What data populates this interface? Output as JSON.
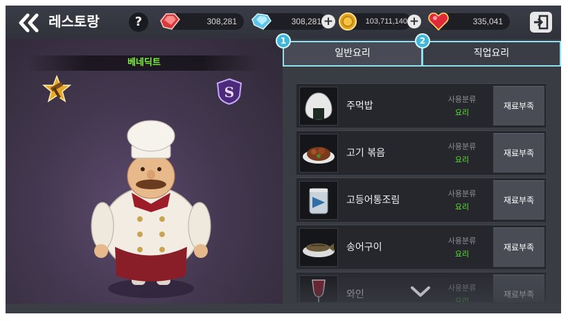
{
  "header": {
    "title": "레스토랑",
    "help_label": "?",
    "resources": [
      {
        "icon": "red-gem-icon",
        "value": "308,281"
      },
      {
        "icon": "blue-gem-icon",
        "value": "308,281"
      },
      {
        "icon": "gold-coin-icon",
        "value": "103,711,140"
      },
      {
        "icon": "heart-gem-icon",
        "value": "335,041"
      }
    ]
  },
  "character": {
    "name": "베네딕트",
    "name_color": "#7cf03a",
    "left_badge_icon": "hammer-star-badge-icon",
    "right_badge_icon": "s-shield-badge-icon"
  },
  "tabs": [
    {
      "marker": "1",
      "label": "일반요리"
    },
    {
      "marker": "2",
      "label": "직업요리"
    }
  ],
  "recipes": [
    {
      "name": "주먹밥",
      "icon": "rice-ball-icon",
      "category_label": "사용분류",
      "category": "요리",
      "button": "재료부족"
    },
    {
      "name": "고기 볶음",
      "icon": "stir-fried-meat-icon",
      "category_label": "사용분류",
      "category": "요리",
      "button": "재료부족"
    },
    {
      "name": "고등어통조림",
      "icon": "canned-mackerel-icon",
      "category_label": "사용분류",
      "category": "요리",
      "button": "재료부족"
    },
    {
      "name": "송어구이",
      "icon": "grilled-trout-icon",
      "category_label": "사용분류",
      "category": "요리",
      "button": "재료부족"
    },
    {
      "name": "와인",
      "icon": "wine-icon",
      "category_label": "사용분류",
      "category": "요리",
      "button": "재료부족"
    }
  ],
  "colors": {
    "tab_accent": "#8fe1f0",
    "marker": "#3fb6dc",
    "category_green": "#59e330"
  }
}
